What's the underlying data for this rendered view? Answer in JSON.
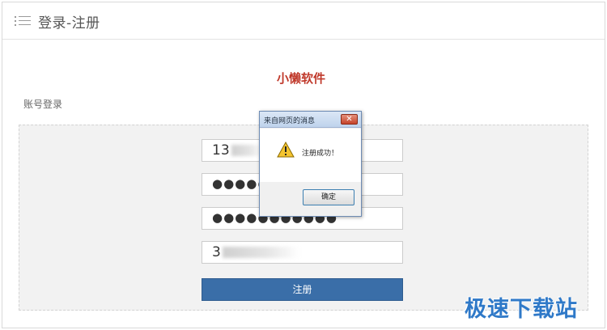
{
  "header": {
    "menu_icon": "list-icon",
    "title": "登录-注册"
  },
  "brand": {
    "name": "小懒软件",
    "color": "#c0392b"
  },
  "form": {
    "section_label": "账号登录",
    "fields": [
      {
        "name": "phone",
        "value": "13"
      },
      {
        "name": "password",
        "value": "●●●●●"
      },
      {
        "name": "confirm_password",
        "value": "●●●●●●●●●●●"
      },
      {
        "name": "code",
        "value": "3"
      }
    ],
    "submit_label": "注册",
    "submit_color": "#3a6ea8"
  },
  "dialog": {
    "title": "来自网页的消息",
    "close_glyph": "✕",
    "icon": "warning-icon",
    "message": "注册成功！",
    "ok_label": "确定"
  },
  "watermark": {
    "text": "极速下载站",
    "color": "#2f79c8"
  }
}
